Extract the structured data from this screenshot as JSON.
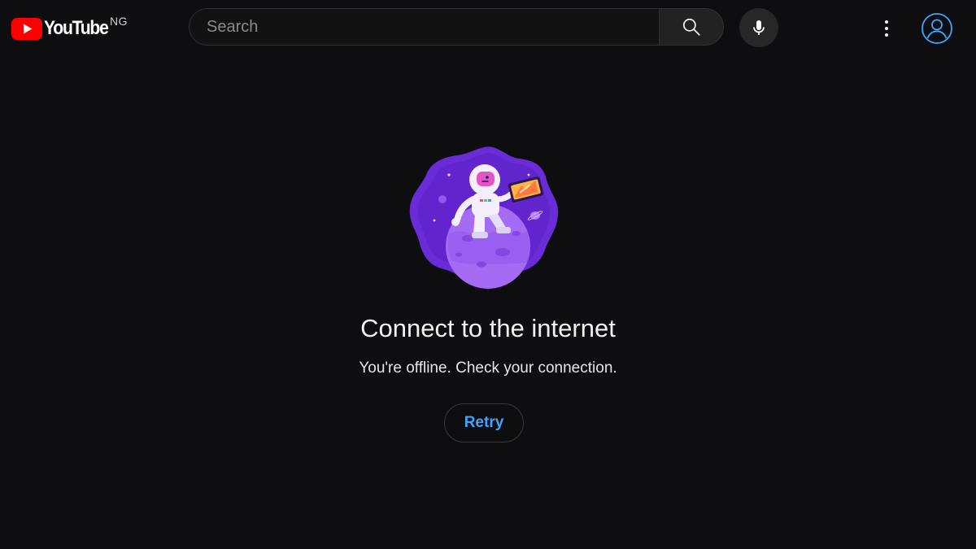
{
  "header": {
    "logo": {
      "wordmark": "YouTube",
      "country_code": "NG",
      "icon": "youtube-play-logo-icon",
      "brand_color": "#ff0000"
    },
    "search": {
      "placeholder": "Search",
      "value": "",
      "button_icon": "search-icon"
    },
    "voice_search_icon": "microphone-icon",
    "more_icon": "vertical-dots-icon",
    "account_icon": "account-circle-icon",
    "account_color": "#3ea6ff"
  },
  "offline": {
    "illustration": "astronaut-on-planet-illustration",
    "title": "Connect to the internet",
    "message": "You're offline. Check your connection.",
    "retry_label": "Retry",
    "accent_color": "#3ea6ff"
  },
  "colors": {
    "background": "#0f0f0f",
    "illustration_purple": "#7c3aed"
  }
}
